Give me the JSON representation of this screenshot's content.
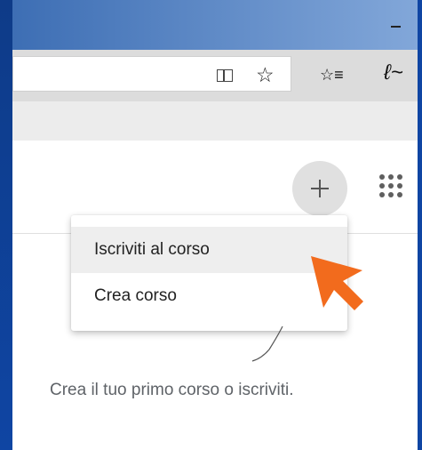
{
  "window": {
    "minimize_icon": "minimize-icon"
  },
  "browser": {
    "address_placeholder": "",
    "reader_icon": "reader-view-icon",
    "favorite_icon": "star-icon",
    "favorites_list_icon": "favorites-list-icon",
    "pen_icon": "pen-icon"
  },
  "header": {
    "add_icon": "plus-icon",
    "apps_icon": "apps-icon"
  },
  "menu": {
    "items": [
      {
        "label": "Iscriviti al corso"
      },
      {
        "label": "Crea corso"
      }
    ]
  },
  "empty_state": {
    "message": "Crea il tuo primo corso o iscriviti."
  },
  "accent_colors": {
    "cursor_arrow": "#f26b1d",
    "window_frame": "#0f3f8f"
  }
}
